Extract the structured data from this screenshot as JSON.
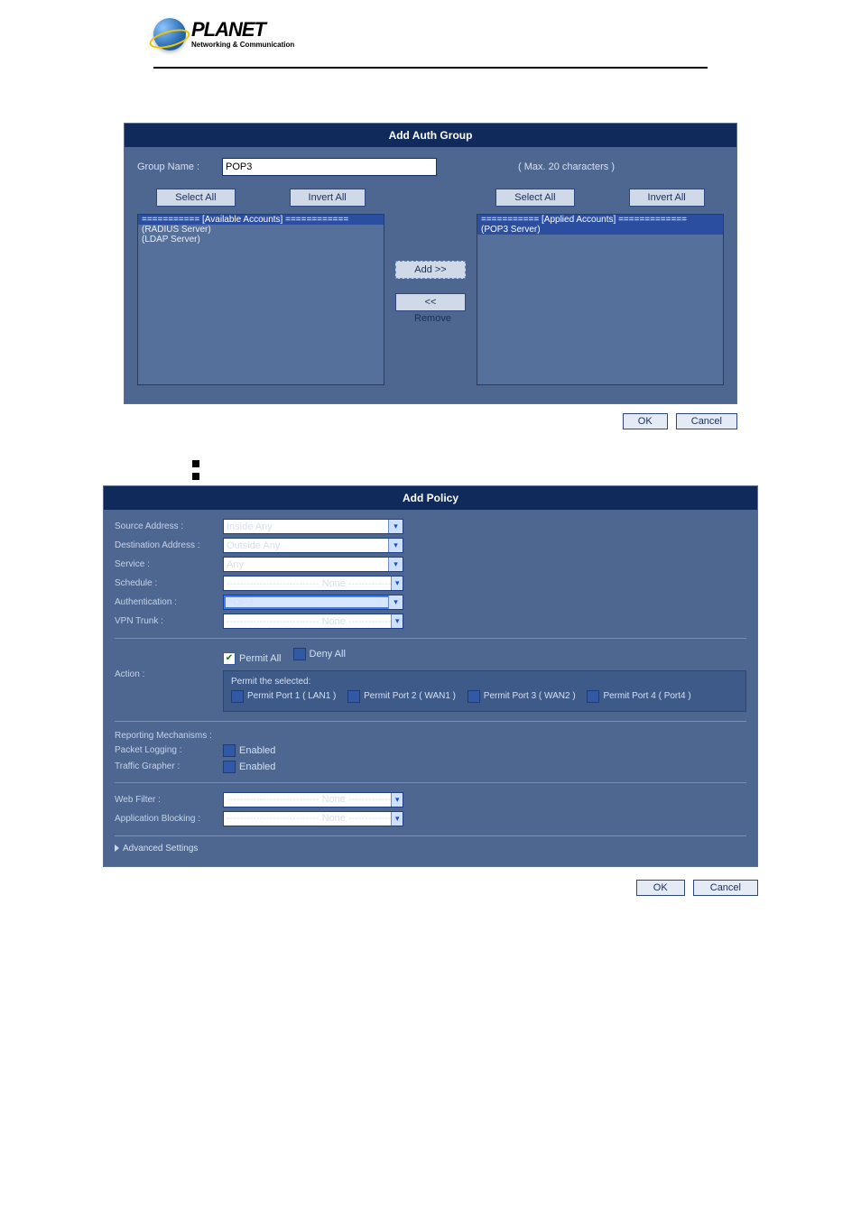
{
  "logo": {
    "title": "PLANET",
    "subtitle": "Networking & Communication"
  },
  "auth_group": {
    "title": "Add Auth Group",
    "group_name_label": "Group Name :",
    "group_name_value": "POP3",
    "hint": "( Max. 20 characters )",
    "buttons": {
      "select_all": "Select All",
      "invert_all": "Invert All",
      "add": "Add >>",
      "remove": "<< Remove"
    },
    "available": {
      "header": "=========== [Available Accounts] ============",
      "items": [
        "(RADIUS Server)",
        "(LDAP Server)"
      ]
    },
    "applied": {
      "header": "=========== [Applied Accounts] =============",
      "items": [
        "(POP3 Server)"
      ]
    },
    "ok": "OK",
    "cancel": "Cancel"
  },
  "policy": {
    "title": "Add Policy",
    "fields": {
      "source_address_label": "Source Address :",
      "source_address_value": "Inside Any",
      "destination_address_label": "Destination Address :",
      "destination_address_value": "Outside Any",
      "service_label": "Service :",
      "service_value": "Any",
      "schedule_label": "Schedule :",
      "schedule_value": "---------------------------- None ----------------------------",
      "authentication_label": "Authentication :",
      "authentication_value": "POP3",
      "vpn_trunk_label": "VPN Trunk :",
      "vpn_trunk_value": "---------------------------- None ----------------------------"
    },
    "action": {
      "label": "Action :",
      "permit_all": "Permit All",
      "deny_all": "Deny All",
      "permit_selected_label": "Permit the selected:",
      "ports": [
        "Permit Port  1  ( LAN1 )",
        "Permit Port  2  ( WAN1 )",
        "Permit Port  3  ( WAN2 )",
        "Permit Port  4  ( Port4 )"
      ]
    },
    "reporting": {
      "label": "Reporting Mechanisms :",
      "packet_logging_label": "Packet Logging :",
      "packet_logging_value": "Enabled",
      "traffic_grapher_label": "Traffic Grapher :",
      "traffic_grapher_value": "Enabled"
    },
    "filters": {
      "web_filter_label": "Web Filter :",
      "web_filter_value": "---------------------------- None ----------------------------",
      "app_blocking_label": "Application Blocking :",
      "app_blocking_value": "---------------------------- None ----------------------------"
    },
    "advanced": "Advanced Settings",
    "ok": "OK",
    "cancel": "Cancel"
  }
}
